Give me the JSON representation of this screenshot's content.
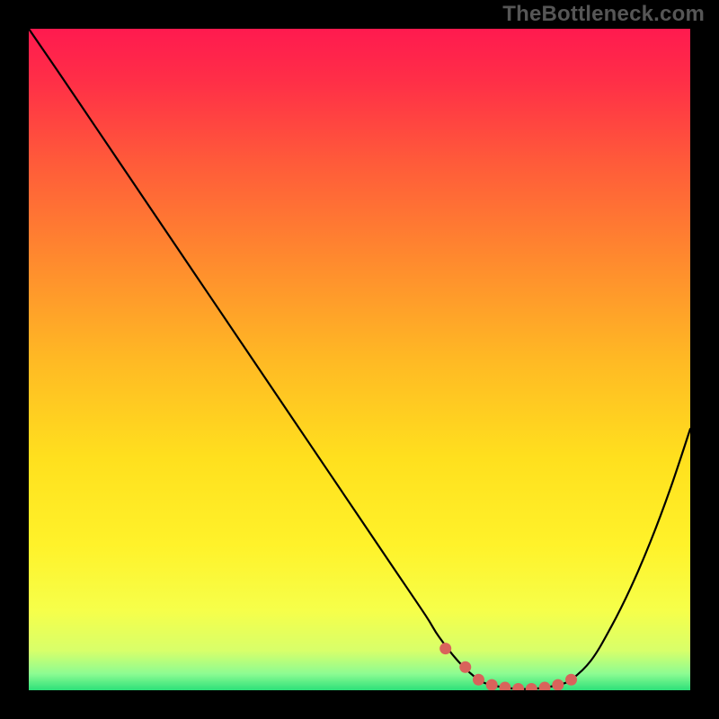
{
  "attribution": "TheBottleneck.com",
  "chart_data": {
    "type": "line",
    "title": "",
    "xlabel": "",
    "ylabel": "",
    "xlim": [
      0,
      100
    ],
    "ylim": [
      0,
      100
    ],
    "x": [
      0,
      5,
      10,
      15,
      20,
      25,
      30,
      35,
      40,
      45,
      50,
      55,
      60,
      62,
      65,
      68,
      70,
      72,
      74,
      76,
      78,
      80,
      82,
      85,
      88,
      91,
      94,
      97,
      100
    ],
    "y_values": [
      100,
      92.7,
      85.3,
      77.9,
      70.5,
      63.1,
      55.7,
      48.3,
      40.9,
      33.5,
      26.1,
      18.7,
      11.3,
      8.1,
      4.3,
      1.6,
      0.8,
      0.4,
      0.2,
      0.2,
      0.4,
      0.8,
      1.6,
      4.5,
      9.5,
      15.5,
      22.5,
      30.5,
      39.5
    ],
    "optimal_range_x": [
      63,
      66,
      68,
      70,
      72,
      74,
      76,
      78,
      80,
      82
    ],
    "optimal_range_y": [
      6.3,
      3.5,
      1.6,
      0.8,
      0.4,
      0.2,
      0.2,
      0.4,
      0.8,
      1.6
    ],
    "dot_color": "#d9635b",
    "curve_color": "#000000",
    "gradient_stops": [
      {
        "offset": 0.0,
        "color": "#ff1a4f"
      },
      {
        "offset": 0.08,
        "color": "#ff2f47"
      },
      {
        "offset": 0.2,
        "color": "#ff5a3a"
      },
      {
        "offset": 0.35,
        "color": "#ff8a2e"
      },
      {
        "offset": 0.5,
        "color": "#ffb924"
      },
      {
        "offset": 0.65,
        "color": "#ffe01e"
      },
      {
        "offset": 0.78,
        "color": "#fff22a"
      },
      {
        "offset": 0.88,
        "color": "#f6ff4a"
      },
      {
        "offset": 0.94,
        "color": "#d8ff6a"
      },
      {
        "offset": 0.975,
        "color": "#8dfc92"
      },
      {
        "offset": 1.0,
        "color": "#2de07a"
      }
    ]
  }
}
